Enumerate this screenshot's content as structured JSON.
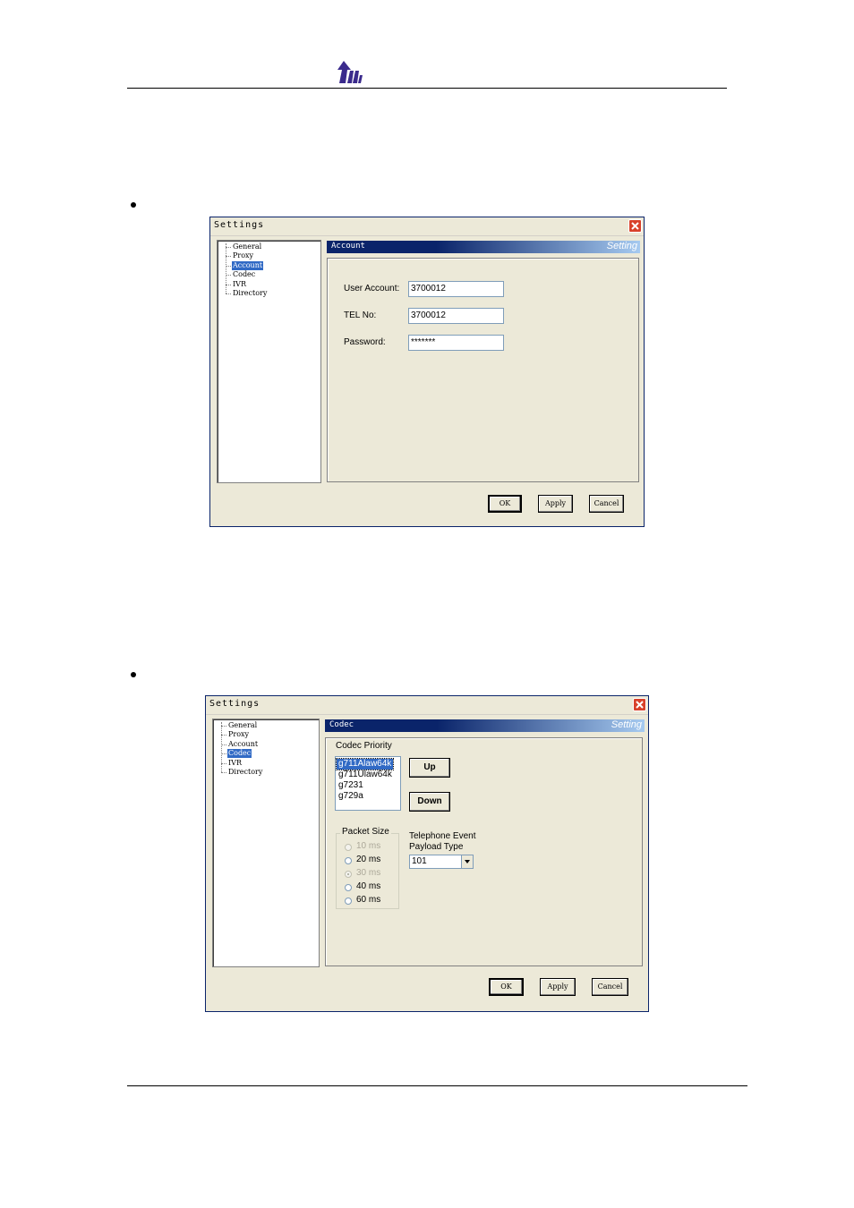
{
  "colors": {
    "accent": "#316ac5",
    "title_bar_dark": "#0a246a",
    "logo": "#3a2a8c",
    "dialog_bg": "#ece9d8"
  },
  "header": {
    "logo_icon": "company-logo-icon"
  },
  "dialog1": {
    "title": "Settings",
    "tree": [
      "General",
      "Proxy",
      "Account",
      "Codec",
      "IVR",
      "Directory"
    ],
    "selected": "Account",
    "section_title": "Account",
    "section_right": "Setting",
    "fields": [
      {
        "label": "User Account:",
        "value": "3700012"
      },
      {
        "label": "TEL No:",
        "value": "3700012"
      },
      {
        "label": "Password:",
        "value": "*******"
      }
    ],
    "buttons": {
      "ok": "OK",
      "apply": "Apply",
      "cancel": "Cancel"
    }
  },
  "dialog2": {
    "title": "Settings",
    "tree": [
      "General",
      "Proxy",
      "Account",
      "Codec",
      "IVR",
      "Directory"
    ],
    "selected": "Codec",
    "section_title": "Codec",
    "section_right": "Setting",
    "codec_priority_label": "Codec Priority",
    "codecs": [
      "g711Alaw64k",
      "g711Ulaw64k",
      "g7231",
      "g729a"
    ],
    "selected_codec": "g711Alaw64k",
    "up_label": "Up",
    "down_label": "Down",
    "packet_size_label": "Packet Size",
    "packet_sizes": [
      {
        "label": "10 ms",
        "enabled": false,
        "checked": false
      },
      {
        "label": "20 ms",
        "enabled": true,
        "checked": false
      },
      {
        "label": "30 ms",
        "enabled": false,
        "checked": true
      },
      {
        "label": "40 ms",
        "enabled": true,
        "checked": false
      },
      {
        "label": "60 ms",
        "enabled": true,
        "checked": false
      }
    ],
    "telephone_event_label": "Telephone Event",
    "payload_type_label": "Payload Type",
    "payload_type_value": "101",
    "buttons": {
      "ok": "OK",
      "apply": "Apply",
      "cancel": "Cancel"
    }
  }
}
